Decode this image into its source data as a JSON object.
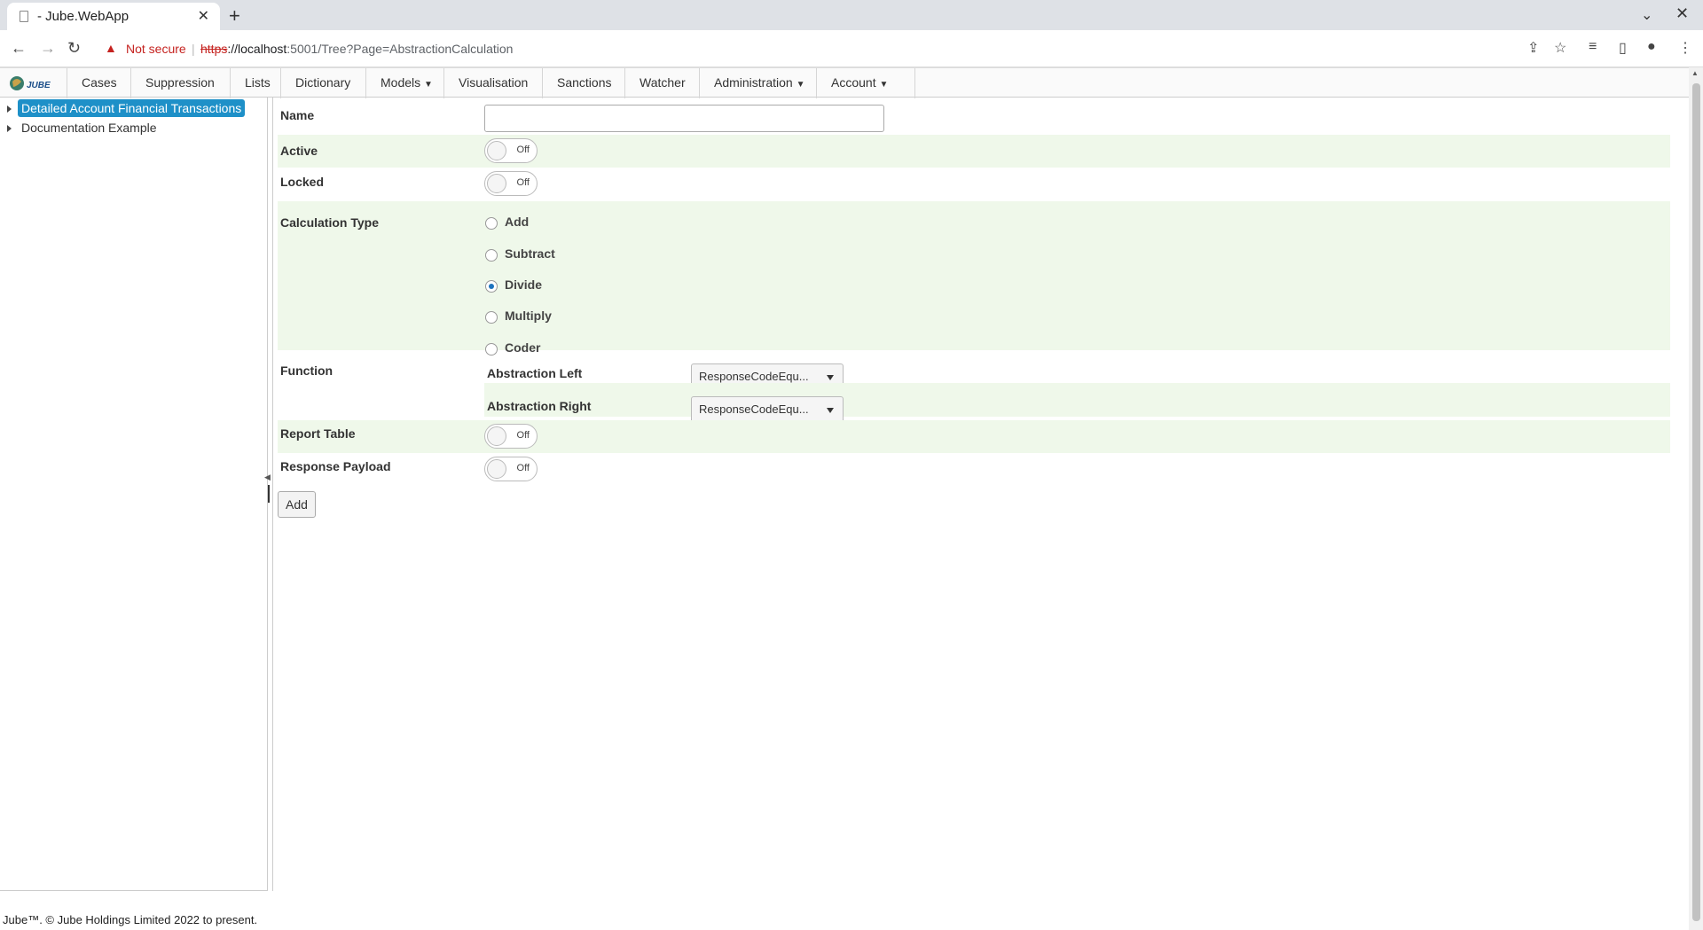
{
  "browser": {
    "tab_title": "- Jube.WebApp",
    "tab_close": "✕",
    "new_tab": "+",
    "not_secure": "Not secure",
    "url_scheme": "https",
    "url_host": "://localhost",
    "url_rest": ":5001/Tree?Page=AbstractionCalculation"
  },
  "menu": {
    "logo_text": "JUBE",
    "items": [
      "Cases",
      "Suppression",
      "Lists",
      "Dictionary",
      "Models",
      "Visualisation",
      "Sanctions",
      "Watcher",
      "Administration",
      "Account"
    ]
  },
  "tree": {
    "nodes": [
      "Detailed Account Financial Transactions",
      "Documentation Example"
    ]
  },
  "form": {
    "name_label": "Name",
    "name_value": "",
    "active_label": "Active",
    "active_state": "Off",
    "locked_label": "Locked",
    "locked_state": "Off",
    "calc_type_label": "Calculation Type",
    "calc_options": [
      "Add",
      "Subtract",
      "Divide",
      "Multiply",
      "Coder"
    ],
    "calc_selected": "Divide",
    "function_label": "Function",
    "abstraction_left_label": "Abstraction Left",
    "abstraction_left_value": "ResponseCodeEqu...",
    "abstraction_right_label": "Abstraction Right",
    "abstraction_right_value": "ResponseCodeEqu...",
    "report_table_label": "Report Table",
    "report_table_state": "Off",
    "response_payload_label": "Response Payload",
    "response_payload_state": "Off",
    "add_button": "Add"
  },
  "footer": {
    "text": "Jube™. © Jube Holdings Limited 2022 to present."
  }
}
